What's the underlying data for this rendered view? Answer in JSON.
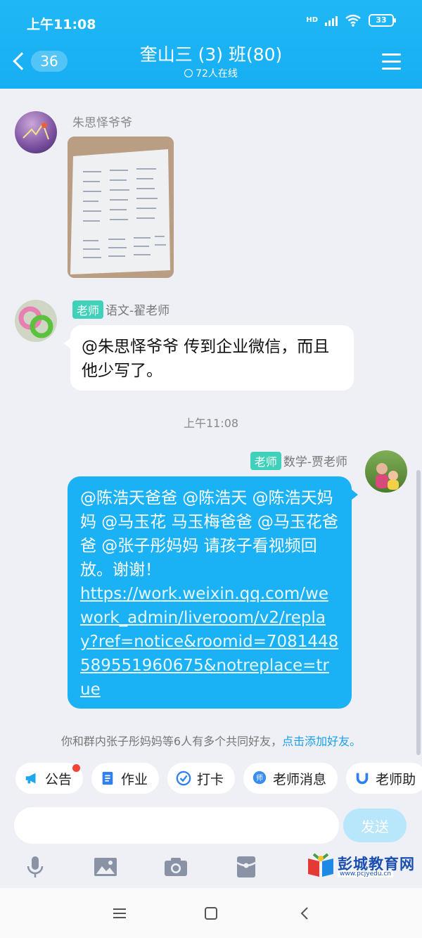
{
  "status_bar": {
    "time": "上午11:08",
    "hd": "HD",
    "battery": "33"
  },
  "header": {
    "back_count": "36",
    "title": "奎山三 (3) 班(80)",
    "online": "72人在线"
  },
  "messages": [
    {
      "type": "image",
      "sender": "朱思怿爷爷"
    },
    {
      "type": "text",
      "role": "老师",
      "sender": "语文-翟老师",
      "text": "@朱思怿爷爷 传到企业微信，而且他少写了。"
    },
    {
      "type": "timestamp",
      "text": "上午11:08"
    },
    {
      "type": "text",
      "role": "老师",
      "sender": "数学-贾老师",
      "text": "@陈浩天爸爸 @陈浩天 @陈浩天妈妈 @马玉花 马玉梅爸爸 @马玉花爸爸 @张子彤妈妈 请孩子看视频回放。谢谢！",
      "link": "https://work.weixin.qq.com/wework_admin/liveroom/v2/replay?ref=notice&roomid=7081448589551960675&notreplace=true"
    }
  ],
  "system_note": {
    "text": "你和群内张子彤妈妈等6人有多个共同好友，",
    "action": "点击添加好友。"
  },
  "quick_actions": [
    "公告",
    "作业",
    "打卡",
    "老师消息",
    "老师助"
  ],
  "input": {
    "placeholder": "",
    "send_label": "发送"
  },
  "watermark": {
    "name": "彭城教育网",
    "url": "www.pcjyedu.cn"
  },
  "colors": {
    "header": "#1fb7f5",
    "bubble_self": "#1ab1f5",
    "badge": "#3fd1b9",
    "link": "#1a9fe8"
  }
}
